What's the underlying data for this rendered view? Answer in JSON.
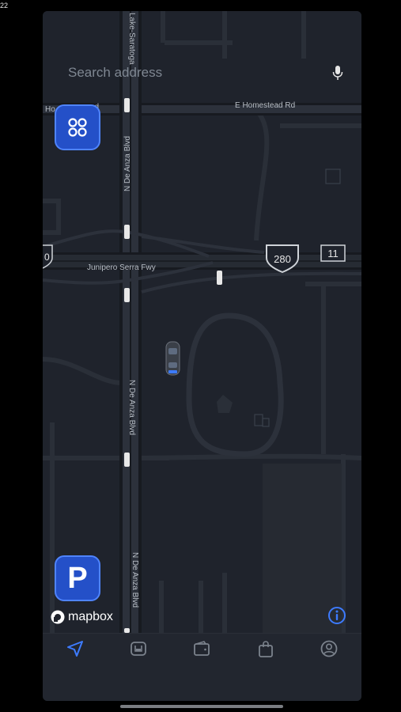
{
  "status": {
    "time": "22"
  },
  "search": {
    "placeholder": "Search address",
    "icon": "mic-icon"
  },
  "map": {
    "labels": {
      "street_top": "E Homestead Rd",
      "street_left": "Ho",
      "street_left2": "ad",
      "freeway": "Junipero Serra Fwy",
      "blvd1": "N De Anza Blvd",
      "blvd2": "N De Anza Blvd",
      "blvd3": "N De Anza Blvd",
      "top_street": "Lake-Saratoga",
      "shield_280": "280",
      "shield_11": "11",
      "shield_left": "0"
    },
    "colors": {
      "background": "#1f232c",
      "road": "#2c313b",
      "road_edge": "#171a20",
      "freeway": "#262b33"
    }
  },
  "buttons": {
    "grid": {
      "icon": "grid-icon"
    },
    "parking": {
      "label": "P"
    }
  },
  "attribution": {
    "text": "mapbox",
    "info_icon": "info-icon"
  },
  "tabbar": {
    "tabs": [
      {
        "icon": "navigation-arrow-icon",
        "active": true
      },
      {
        "icon": "vehicle-icon",
        "active": false
      },
      {
        "icon": "wallet-icon",
        "active": false
      },
      {
        "icon": "shopping-bag-icon",
        "active": false
      },
      {
        "icon": "profile-icon",
        "active": false
      }
    ],
    "accent": "#3d7bff"
  }
}
